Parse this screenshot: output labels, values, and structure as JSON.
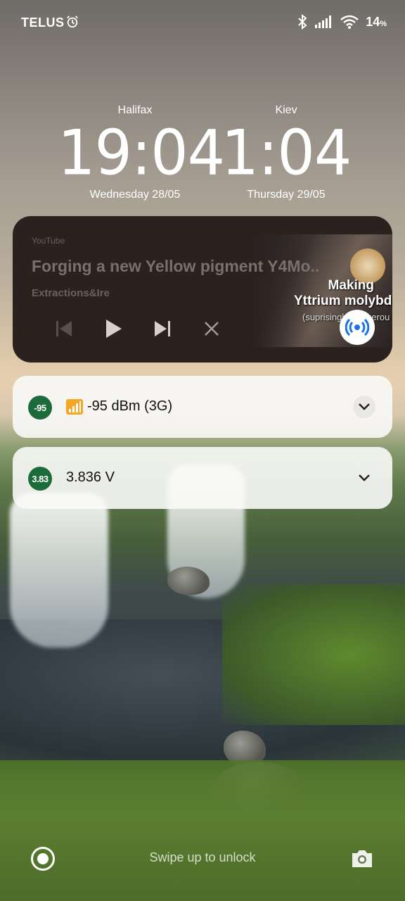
{
  "status_bar": {
    "carrier": "TELUS",
    "battery_percent": "14",
    "battery_unit": "%",
    "icons": [
      "alarm-icon",
      "bluetooth-icon",
      "signal-icon",
      "wifi-icon"
    ]
  },
  "clocks": [
    {
      "city": "Halifax",
      "time": "19:04",
      "date": "Wednesday 28/05"
    },
    {
      "city": "Kiev",
      "time": "1:04",
      "date": "Thursday 29/05"
    }
  ],
  "media": {
    "app": "YouTube",
    "title": "Forging a new Yellow pigment Y4Mo..",
    "artist": "Extractions&Ire",
    "thumbnail_text": {
      "line1": "Making",
      "line2": "Yttrium molybda",
      "line3": "(suprisingly dangerou"
    },
    "controls": [
      "previous-icon",
      "play-icon",
      "next-icon",
      "close-icon"
    ],
    "cast_icon": "cast-icon"
  },
  "notifications": [
    {
      "badge": "-95",
      "text": "-95 dBm (3G)",
      "icon": "signal-bars-emoji-icon",
      "badge_color": "#1d6b3a"
    },
    {
      "badge": "3.83",
      "text": "3.836 V",
      "badge_color": "#1d6b3a"
    }
  ],
  "lockscreen": {
    "swipe_hint": "Swipe up to unlock",
    "left_shortcut": "assistant-icon",
    "right_shortcut": "camera-icon"
  }
}
